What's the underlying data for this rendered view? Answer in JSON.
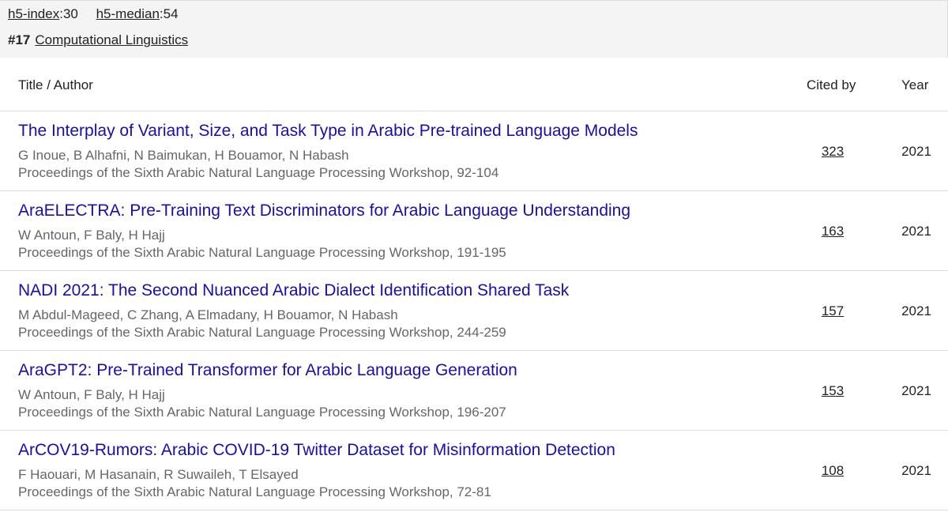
{
  "metrics": {
    "h5_index_label": "h5-index",
    "h5_index_value": ":30",
    "h5_median_label": "h5-median",
    "h5_median_value": ":54"
  },
  "category": {
    "rank": "#17",
    "name": "Computational Linguistics"
  },
  "table": {
    "headers": {
      "title": "Title / Author",
      "cited": "Cited by",
      "year": "Year"
    },
    "rows": [
      {
        "title": "The Interplay of Variant, Size, and Task Type in Arabic Pre-trained Language Models",
        "authors": "G Inoue, B Alhafni, N Baimukan, H Bouamor, N Habash",
        "venue": "Proceedings of the Sixth Arabic Natural Language Processing Workshop, 92-104",
        "cited": "323",
        "year": "2021"
      },
      {
        "title": "AraELECTRA: Pre-Training Text Discriminators for Arabic Language Understanding",
        "authors": "W Antoun, F Baly, H Hajj",
        "venue": "Proceedings of the Sixth Arabic Natural Language Processing Workshop, 191-195",
        "cited": "163",
        "year": "2021"
      },
      {
        "title": "NADI 2021: The Second Nuanced Arabic Dialect Identification Shared Task",
        "authors": "M Abdul-Mageed, C Zhang, A Elmadany, H Bouamor, N Habash",
        "venue": "Proceedings of the Sixth Arabic Natural Language Processing Workshop, 244-259",
        "cited": "157",
        "year": "2021"
      },
      {
        "title": "AraGPT2: Pre-Trained Transformer for Arabic Language Generation",
        "authors": "W Antoun, F Baly, H Hajj",
        "venue": "Proceedings of the Sixth Arabic Natural Language Processing Workshop, 196-207",
        "cited": "153",
        "year": "2021"
      },
      {
        "title": "ArCOV19-Rumors: Arabic COVID-19 Twitter Dataset for Misinformation Detection",
        "authors": "F Haouari, M Hasanain, R Suwaileh, T Elsayed",
        "venue": "Proceedings of the Sixth Arabic Natural Language Processing Workshop, 72-81",
        "cited": "108",
        "year": "2021"
      }
    ]
  },
  "colors": {
    "link_title": "#1a0dab",
    "meta_text": "#666666",
    "topbar_bg": "#f4f4f4"
  }
}
